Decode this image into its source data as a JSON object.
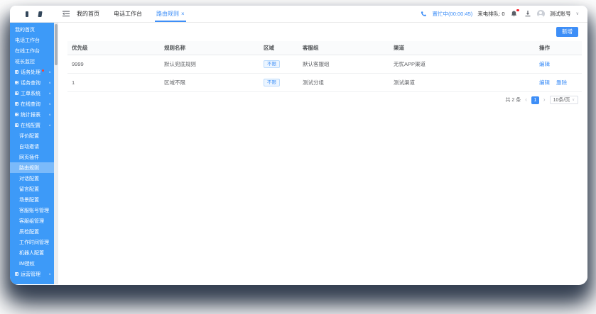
{
  "colors": {
    "accent": "#3d8ef7",
    "sidebar_bg": "#3d9af8",
    "badge_red": "#f5222d",
    "tag_bg": "#ecf5ff"
  },
  "icons": {
    "close": "×",
    "caret_down": "∨",
    "chevron_down": "∨",
    "chevron_up": "∧",
    "prev": "‹",
    "next": "›"
  },
  "topbar": {
    "tabs": [
      {
        "label": "我的首页"
      },
      {
        "label": "电话工作台"
      },
      {
        "label": "路由规则"
      }
    ],
    "status": {
      "phone_state": "置忙中(00:00:45)",
      "queue_label": "来电排队: 0",
      "username": "测试账号"
    }
  },
  "sidebar": {
    "items": [
      {
        "label": "我的首页"
      },
      {
        "label": "电话工作台"
      },
      {
        "label": "在线工作台"
      },
      {
        "label": "班长监控"
      },
      {
        "label": "话务处理"
      },
      {
        "label": "话务查询"
      },
      {
        "label": "工单系统"
      },
      {
        "label": "在线查询"
      },
      {
        "label": "统计报表"
      },
      {
        "label": "在线配置"
      },
      {
        "label": "运营管理"
      }
    ],
    "config_children": [
      "评价配置",
      "自动邀请",
      "网页插件",
      "路由规则",
      "对话配置",
      "留言配置",
      "场景配置",
      "客服账号管理",
      "客服组管理",
      "质检配置",
      "工作时间管理",
      "机器人配置",
      "IM授权"
    ],
    "active_child": "路由规则"
  },
  "content": {
    "add_button": "新增",
    "table": {
      "columns": [
        "优先级",
        "规则名称",
        "区域",
        "客服组",
        "渠道",
        "操作"
      ],
      "rows": [
        {
          "priority": "9999",
          "name": "默认兜底规则",
          "region_tag": "不限",
          "group": "默认客服组",
          "channel": "无忧APP渠道",
          "actions": [
            "编辑"
          ]
        },
        {
          "priority": "1",
          "name": "区域不限",
          "region_tag": "不限",
          "group": "测试分组",
          "channel": "测试渠道",
          "actions": [
            "编辑",
            "删除"
          ]
        }
      ]
    },
    "pagination": {
      "total": "共 2 条",
      "current_page": "1",
      "page_size": "10条/页"
    }
  }
}
